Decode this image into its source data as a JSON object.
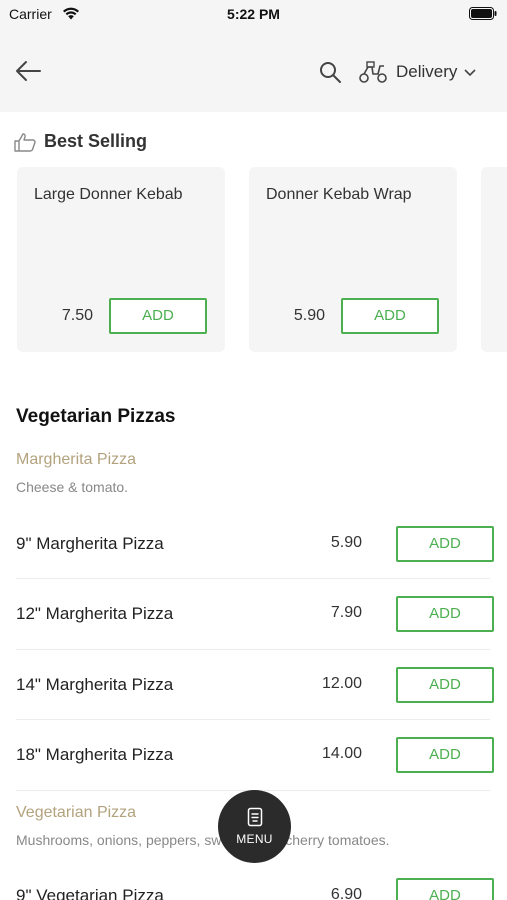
{
  "status_bar": {
    "carrier": "Carrier",
    "time": "5:22 PM"
  },
  "nav": {
    "back_icon": "arrow-left-icon",
    "search_icon": "search-icon",
    "delivery_icon": "scooter-icon",
    "delivery_label": "Delivery"
  },
  "best_selling": {
    "title": "Best Selling",
    "items": [
      {
        "name": "Large Donner Kebab",
        "price": "7.50",
        "add_label": "ADD"
      },
      {
        "name": "Donner Kebab Wrap",
        "price": "5.90",
        "add_label": "ADD"
      }
    ]
  },
  "category": {
    "title": "Vegetarian Pizzas",
    "groups": [
      {
        "name": "Margherita Pizza",
        "description": "Cheese & tomato.",
        "items": [
          {
            "name": "9\" Margherita Pizza",
            "price": "5.90",
            "add_label": "ADD"
          },
          {
            "name": "12\" Margherita Pizza",
            "price": "7.90",
            "add_label": "ADD"
          },
          {
            "name": "14\" Margherita Pizza",
            "price": "12.00",
            "add_label": "ADD"
          },
          {
            "name": "18\" Margherita Pizza",
            "price": "14.00",
            "add_label": "ADD"
          }
        ]
      },
      {
        "name": "Vegetarian Pizza",
        "description": "Mushrooms, onions, peppers, sweetcorn & cherry tomatoes.",
        "items": [
          {
            "name": "9\" Vegetarian Pizza",
            "price": "6.90",
            "add_label": "ADD"
          }
        ]
      }
    ]
  },
  "menu_button": {
    "label": "MENU",
    "icon": "menu-book-icon"
  },
  "colors": {
    "accent": "#4caf50",
    "group_name": "#b3a27e",
    "header_bg": "#f5f5f5",
    "fab_bg": "#2b2b2b"
  }
}
